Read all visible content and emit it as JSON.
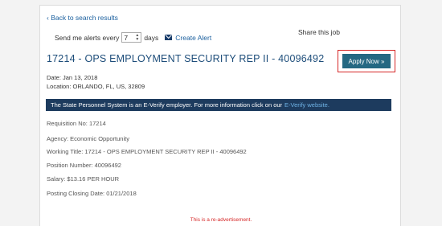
{
  "nav": {
    "back_label": "Back to search results"
  },
  "alerts": {
    "prefix": "Send me alerts every",
    "frequency_value": "7",
    "suffix": "days",
    "create_label": "Create Alert"
  },
  "share": {
    "label": "Share this job"
  },
  "job": {
    "title": "17214 - OPS EMPLOYMENT SECURITY REP II - 40096492",
    "date": "Date: Jan 13, 2018",
    "location": "Location: ORLANDO, FL, US, 32809"
  },
  "apply": {
    "label": "Apply Now »",
    "highlight_color": "#d62828"
  },
  "banner": {
    "text": "The State Personnel System is an E-Verify employer. For more information click on our",
    "link_text": "E-Verify website."
  },
  "details": {
    "requisition": "Requisition No: 17214",
    "agency": "Agency: Economic Opportunity",
    "working_title": "Working Title: 17214 - OPS EMPLOYMENT SECURITY REP II - 40096492",
    "position_number": "Position Number: 40096492",
    "salary": "Salary:  $13.16 PER HOUR",
    "closing_date": "Posting Closing Date: 01/21/2018"
  },
  "notice": "This is a re-advertisement.",
  "icons": {
    "back": "chevron-left-icon",
    "alert": "envelope-icon"
  }
}
